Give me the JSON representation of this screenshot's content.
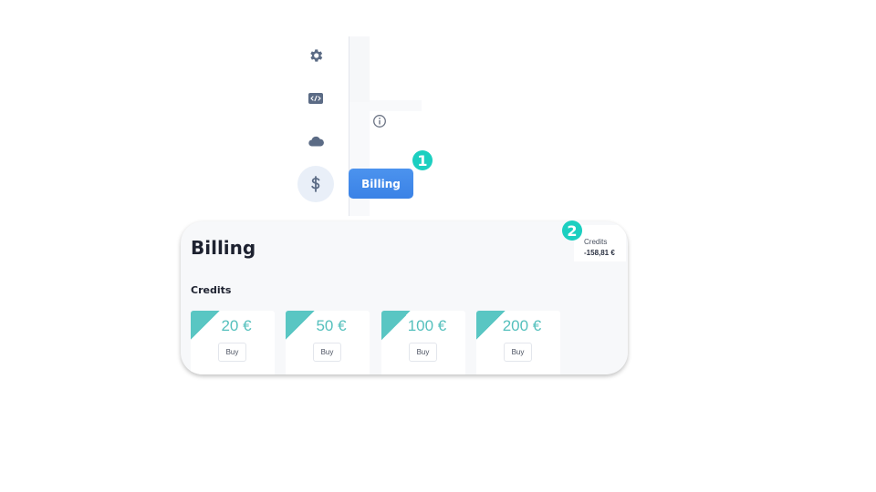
{
  "sidebar": {
    "items": [
      {
        "name": "settings",
        "icon": "gear-icon"
      },
      {
        "name": "developer",
        "icon": "code-icon"
      },
      {
        "name": "cloud",
        "icon": "cloud-icon"
      },
      {
        "name": "billing",
        "icon": "dollar-icon",
        "active": true
      }
    ]
  },
  "tooltip": {
    "billing_label": "Billing"
  },
  "badges": {
    "step1": "1",
    "step2": "2"
  },
  "billing": {
    "title": "Billing",
    "balance": {
      "label": "Credits",
      "value": "-158,81 €"
    },
    "credits_section": "Credits",
    "packs": [
      {
        "amount": "20 €",
        "buy_label": "Buy"
      },
      {
        "amount": "50 €",
        "buy_label": "Buy"
      },
      {
        "amount": "100 €",
        "buy_label": "Buy"
      },
      {
        "amount": "200 €",
        "buy_label": "Buy"
      }
    ]
  },
  "colors": {
    "accent_blue": "#3a82e6",
    "badge_teal": "#1ccfc0",
    "pack_teal": "#59c6c3",
    "icon_slate": "#5b6b85"
  }
}
